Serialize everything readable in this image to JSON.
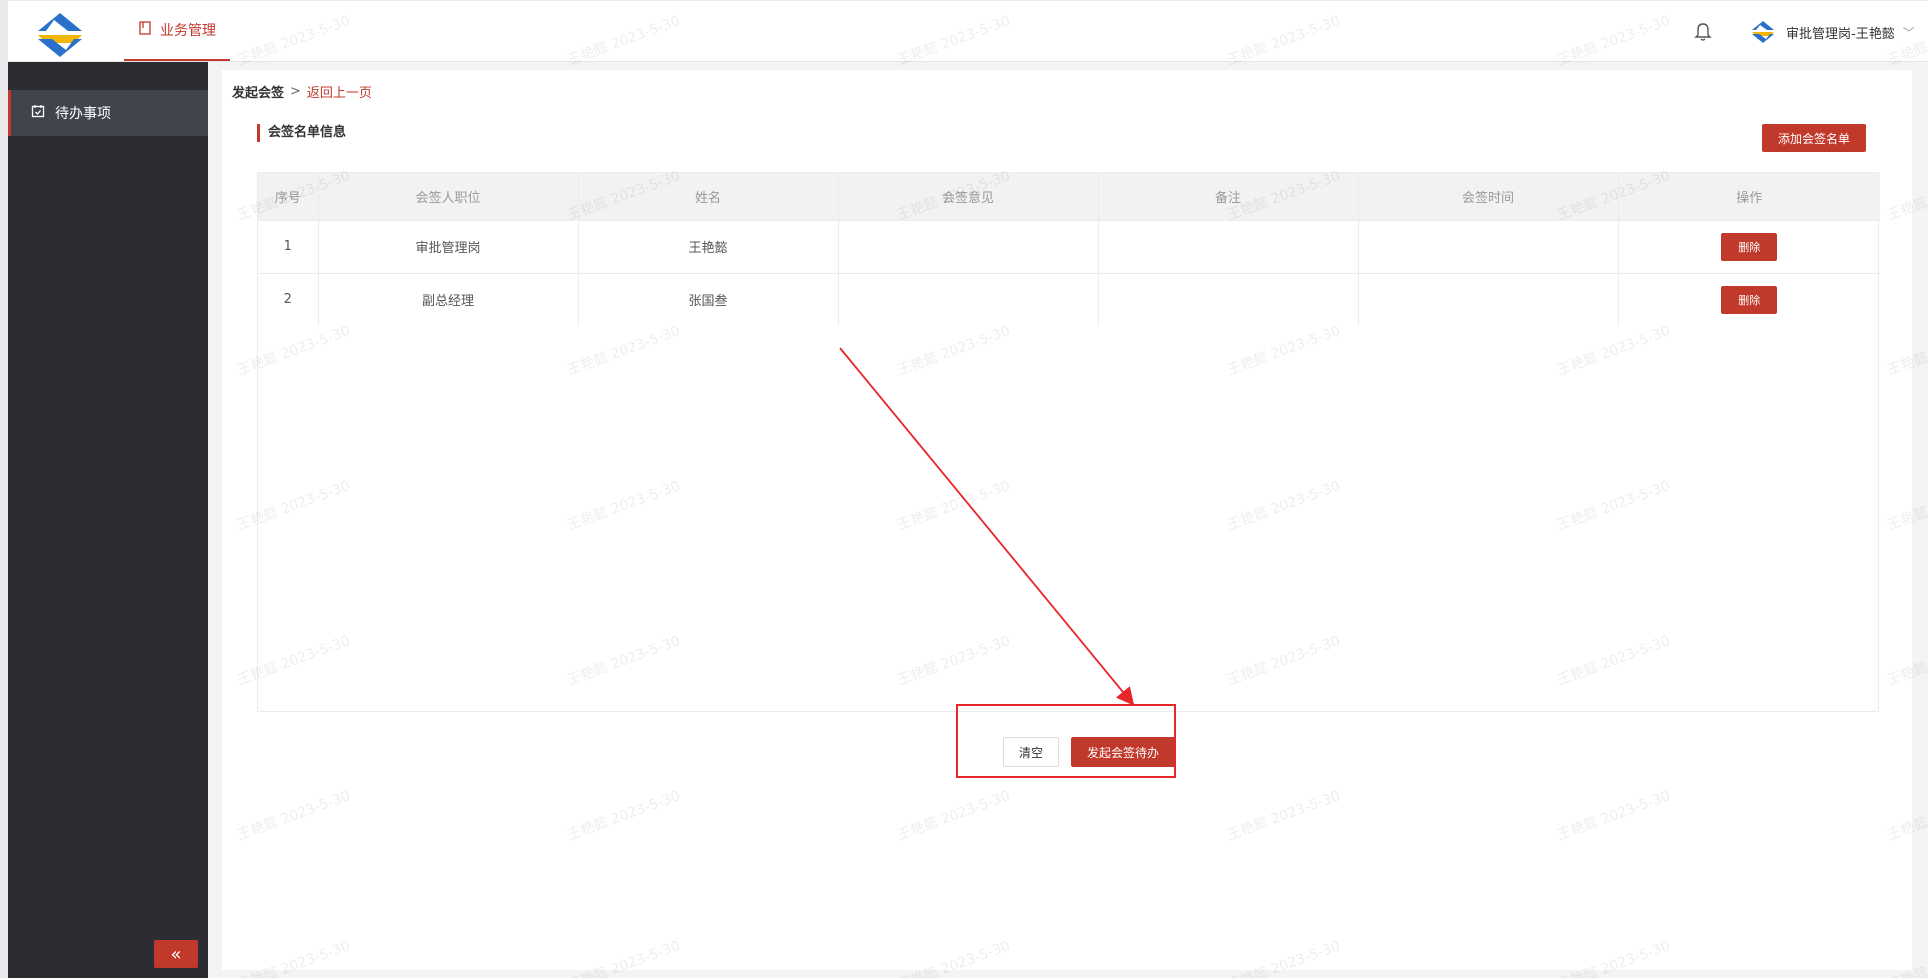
{
  "header": {
    "nav_tab": "业务管理",
    "user_label": "审批管理岗-王艳懿"
  },
  "sidebar": {
    "items": [
      {
        "label": "待办事项"
      }
    ]
  },
  "breadcrumb": {
    "current": "发起会签",
    "separator": ">",
    "back": "返回上一页"
  },
  "section": {
    "title": "会签名单信息",
    "add_button": "添加会签名单"
  },
  "table": {
    "columns": [
      "序号",
      "会签人职位",
      "姓名",
      "会签意见",
      "备注",
      "会签时间",
      "操作"
    ],
    "rows": [
      {
        "index": "1",
        "position": "审批管理岗",
        "name": "王艳懿",
        "opinion": "",
        "remark": "",
        "time": "",
        "action": "删除"
      },
      {
        "index": "2",
        "position": "副总经理",
        "name": "张国叁",
        "opinion": "",
        "remark": "",
        "time": "",
        "action": "删除"
      }
    ]
  },
  "actions": {
    "clear": "清空",
    "submit": "发起会签待办"
  },
  "watermark": "王艳懿 2023-5-30",
  "colors": {
    "accent": "#c0392b",
    "sidebar_bg": "#2b2d33",
    "sidebar_active": "#41444c",
    "annotation": "#e8262a"
  },
  "icons": {
    "nav_tab": "book-icon",
    "sidebar_item": "calendar-check-icon",
    "bell": "bell-icon",
    "collapse": "double-chevron-left-icon",
    "user_dropdown": "chevron-down-icon"
  }
}
